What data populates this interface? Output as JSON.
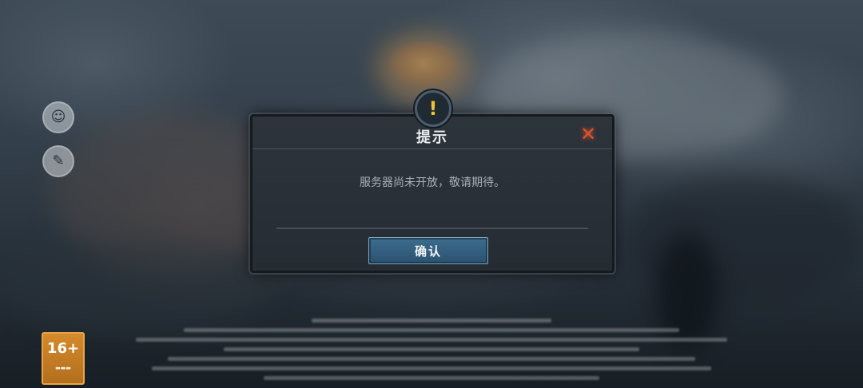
{
  "dialog": {
    "title": "提示",
    "message": "服务器尚未开放，敬请期待。",
    "confirm_label": "确认",
    "warning_icon": "exclamation-icon",
    "close_icon": "close-icon"
  },
  "side_buttons": [
    {
      "icon": "avatar-icon",
      "glyph": "☺"
    },
    {
      "icon": "notice-icon",
      "glyph": "✎"
    }
  ],
  "age_rating": {
    "label": "16+"
  },
  "colors": {
    "accent_button": "#3e6d8e",
    "close_red": "#e0522b",
    "warning_yellow": "#f1c232",
    "age_badge_orange": "#d58a2a"
  }
}
